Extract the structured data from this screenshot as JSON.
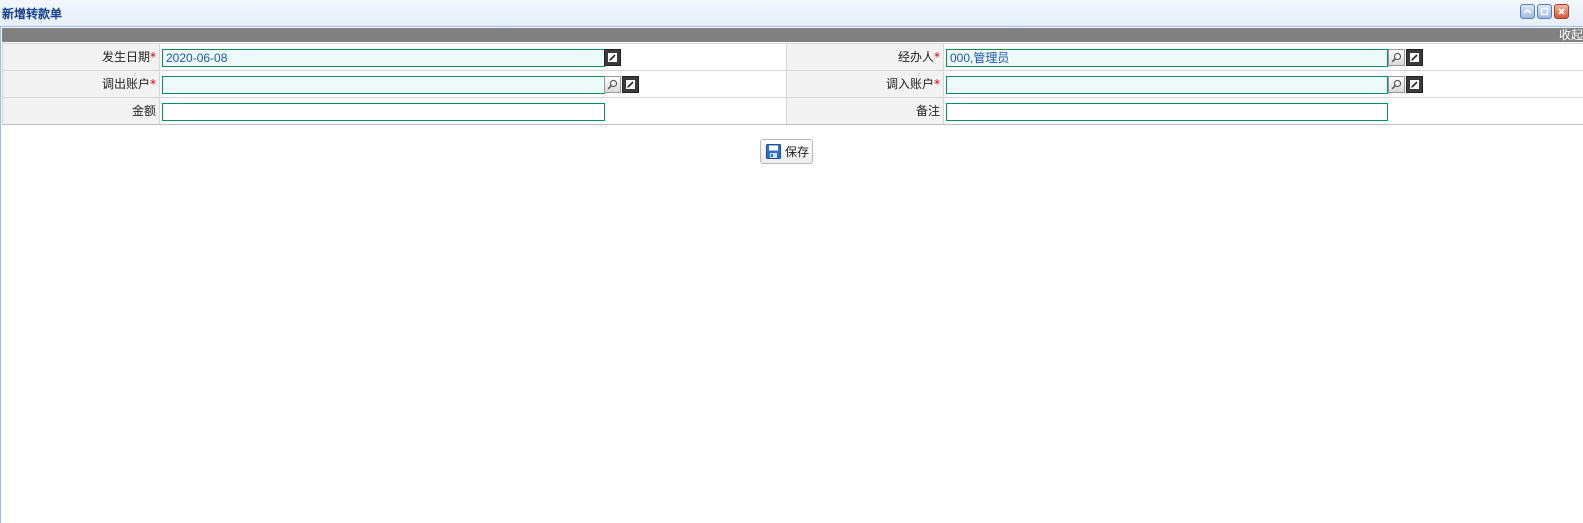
{
  "window": {
    "title": "新增转款单",
    "controls": [
      "collapse-icon",
      "restore-icon",
      "close-icon"
    ]
  },
  "panel": {
    "collapse_label": "收起"
  },
  "form": {
    "date": {
      "label": "发生日期",
      "required_mark": "*",
      "value": "2020-06-08"
    },
    "handler": {
      "label": "经办人",
      "required_mark": "*",
      "value": "000,管理员"
    },
    "out_account": {
      "label": "调出账户",
      "required_mark": "*",
      "value": ""
    },
    "in_account": {
      "label": "调入账户",
      "required_mark": "*",
      "value": ""
    },
    "amount": {
      "label": "金额",
      "value": ""
    },
    "remark": {
      "label": "备注",
      "value": ""
    }
  },
  "actions": {
    "save_label": "保存"
  },
  "colors": {
    "titlebar": "#e6eef9",
    "strip": "#808080",
    "field_border": "#0b8f5a",
    "field_bg": "#eefaf9",
    "label_bg": "#f2f2f2",
    "value_text": "#1a56b8",
    "required": "#d40000"
  }
}
